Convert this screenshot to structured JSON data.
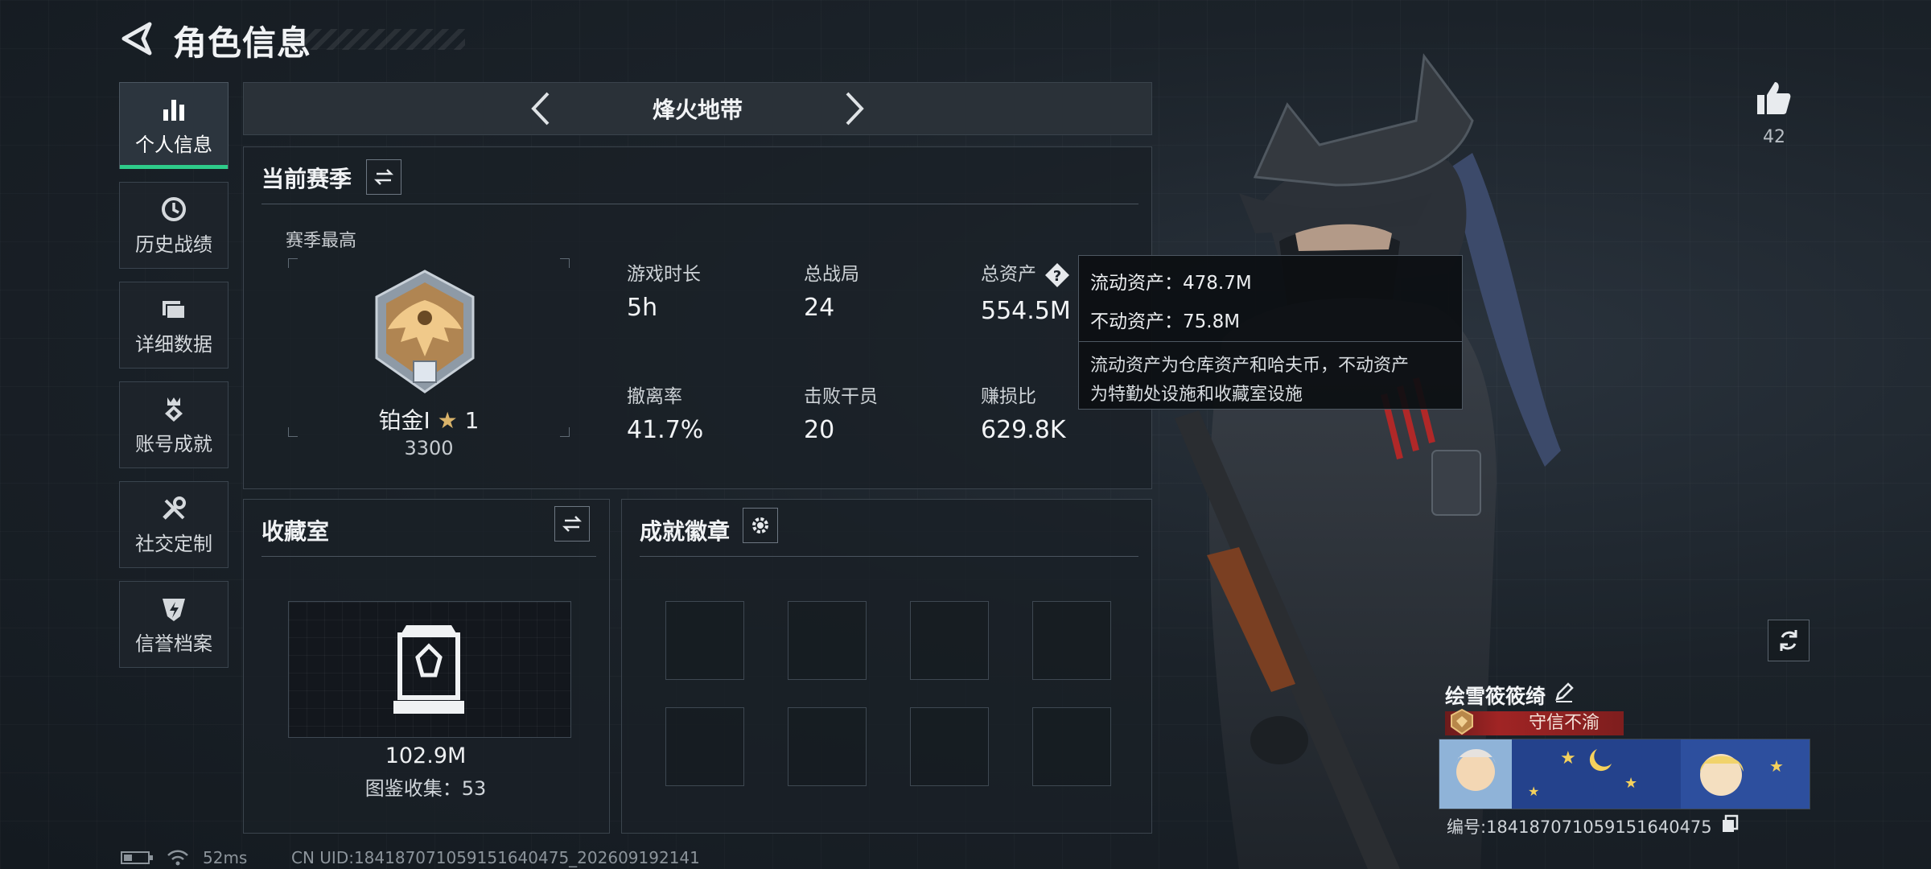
{
  "header": {
    "title": "角色信息"
  },
  "nav": {
    "items": [
      {
        "label": "个人信息",
        "icon": "bar-chart-icon",
        "active": true
      },
      {
        "label": "历史战绩",
        "icon": "history-clock-icon",
        "active": false
      },
      {
        "label": "详细数据",
        "icon": "folder-icon",
        "active": false
      },
      {
        "label": "账号成就",
        "icon": "achievement-icon",
        "active": false
      },
      {
        "label": "社交定制",
        "icon": "tools-icon",
        "active": false
      },
      {
        "label": "信誉档案",
        "icon": "reputation-icon",
        "active": false
      }
    ]
  },
  "mode": {
    "title": "烽火地带"
  },
  "season": {
    "heading": "当前赛季",
    "best_label": "赛季最高",
    "rank_name": "铂金Ⅰ",
    "rank_stars": "1",
    "rank_score": "3300",
    "stats": [
      {
        "key": "游戏时长",
        "value": "5h"
      },
      {
        "key": "总战局",
        "value": "24"
      },
      {
        "key": "总资产",
        "value": "554.5M"
      },
      {
        "key": "撤离率",
        "value": "41.7%"
      },
      {
        "key": "击败干员",
        "value": "20"
      },
      {
        "key": "赚损比",
        "value": "629.8K"
      }
    ]
  },
  "tooltip": {
    "liquid": "流动资产：478.7M",
    "fixed": "不动资产：75.8M",
    "desc_1": "流动资产为仓库资产和哈夫币，不动资产",
    "desc_2": "为特勤处设施和收藏室设施"
  },
  "collection": {
    "heading": "收藏室",
    "value": "102.9M",
    "count": "图鉴收集：53"
  },
  "achievements": {
    "heading": "成就徽章"
  },
  "profile": {
    "likes": "42",
    "name": "绘雪筱筱绮",
    "honor": "守信不渝",
    "id": "编号:184187071059151640475"
  },
  "status": {
    "ping": "52ms",
    "uid": "CN UID:184187071059151640475_202609192141"
  },
  "colors": {
    "accent": "#2ecc8a",
    "honor": "#a02424"
  }
}
